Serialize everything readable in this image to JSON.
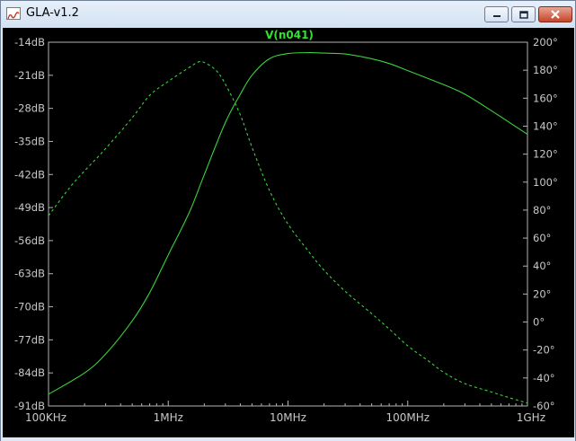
{
  "window": {
    "title": "GLA-v1.2",
    "app_icon": "waveform-icon",
    "buttons": [
      "minimize-icon",
      "maximize-icon",
      "close-icon"
    ]
  },
  "colors": {
    "background": "#000000",
    "trace": "#3ad23a",
    "trace_title": "#33e033",
    "axis_text": "#c8c8c8",
    "frame": "#b4b4b4"
  },
  "chart_data": {
    "type": "line",
    "title": "V(n041)",
    "xscale": "log",
    "xlim": [
      100000,
      1000000000
    ],
    "x_ticks": [
      {
        "value": 100000,
        "label": "100KHz"
      },
      {
        "value": 1000000,
        "label": "1MHz"
      },
      {
        "value": 10000000,
        "label": "10MHz"
      },
      {
        "value": 100000000,
        "label": "100MHz"
      },
      {
        "value": 1000000000,
        "label": "1GHz"
      }
    ],
    "ylim_left": [
      -91,
      -14
    ],
    "y_left_ticks": [
      "-14dB",
      "-21dB",
      "-28dB",
      "-35dB",
      "-42dB",
      "-49dB",
      "-56dB",
      "-63dB",
      "-70dB",
      "-77dB",
      "-84dB",
      "-91dB"
    ],
    "ylim_right": [
      -60,
      200
    ],
    "y_right_ticks": [
      "200°",
      "180°",
      "160°",
      "140°",
      "120°",
      "100°",
      "80°",
      "60°",
      "40°",
      "20°",
      "0°",
      "-20°",
      "-40°",
      "-60°"
    ],
    "grid": false,
    "series": [
      {
        "axis": "left",
        "style": "solid",
        "points": [
          [
            100000,
            -88.5
          ],
          [
            200000,
            -84
          ],
          [
            300000,
            -80
          ],
          [
            500000,
            -73
          ],
          [
            700000,
            -67
          ],
          [
            1000000,
            -59
          ],
          [
            1500000,
            -50
          ],
          [
            2000000,
            -42
          ],
          [
            3000000,
            -31
          ],
          [
            4000000,
            -25
          ],
          [
            5000000,
            -21
          ],
          [
            7000000,
            -17.5
          ],
          [
            10000000,
            -16.4
          ],
          [
            15000000,
            -16.2
          ],
          [
            20000000,
            -16.3
          ],
          [
            30000000,
            -16.5
          ],
          [
            50000000,
            -17.5
          ],
          [
            70000000,
            -18.5
          ],
          [
            100000000,
            -20
          ],
          [
            200000000,
            -23
          ],
          [
            300000000,
            -25
          ],
          [
            500000000,
            -28.5
          ],
          [
            1000000000,
            -33.5
          ]
        ]
      },
      {
        "axis": "right",
        "style": "dashed",
        "points": [
          [
            100000,
            76
          ],
          [
            150000,
            96
          ],
          [
            200000,
            108
          ],
          [
            300000,
            124
          ],
          [
            500000,
            146
          ],
          [
            700000,
            162
          ],
          [
            1000000,
            172
          ],
          [
            1500000,
            182
          ],
          [
            1800000,
            186
          ],
          [
            2000000,
            185.5
          ],
          [
            2500000,
            180
          ],
          [
            3000000,
            170
          ],
          [
            4000000,
            148
          ],
          [
            5000000,
            125
          ],
          [
            7000000,
            94
          ],
          [
            10000000,
            70
          ],
          [
            15000000,
            50
          ],
          [
            20000000,
            37
          ],
          [
            30000000,
            22
          ],
          [
            50000000,
            6
          ],
          [
            70000000,
            -5
          ],
          [
            100000000,
            -17
          ],
          [
            150000000,
            -28
          ],
          [
            200000000,
            -36
          ],
          [
            300000000,
            -44
          ],
          [
            500000000,
            -50
          ],
          [
            700000000,
            -54
          ],
          [
            1000000000,
            -58
          ]
        ]
      }
    ]
  }
}
